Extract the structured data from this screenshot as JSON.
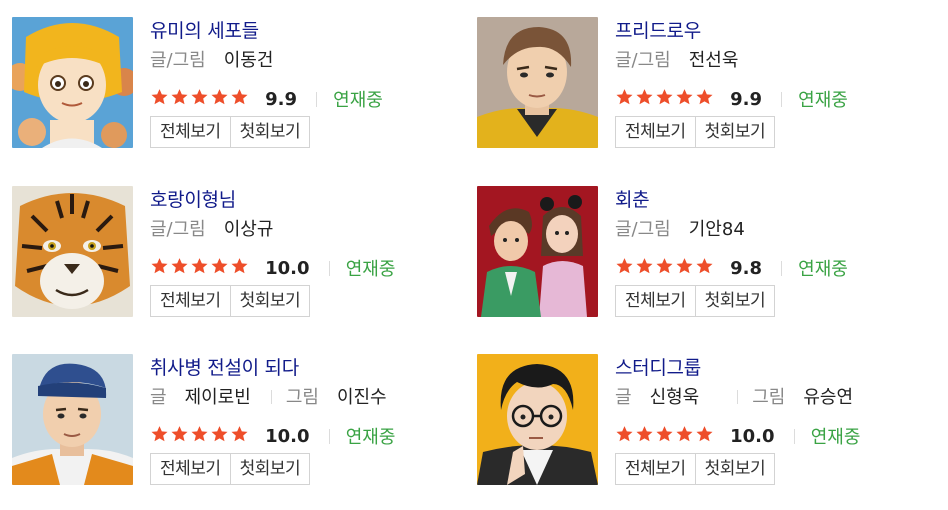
{
  "webtoons": [
    {
      "title": "유미의 세포들",
      "credits": [
        {
          "label": "글/그림",
          "name": "이동건"
        }
      ],
      "rating": "9.9",
      "stars": 5,
      "status": "연재중",
      "buttons": {
        "all": "전체보기",
        "first": "첫회보기"
      }
    },
    {
      "title": "프리드로우",
      "credits": [
        {
          "label": "글/그림",
          "name": "전선욱"
        }
      ],
      "rating": "9.9",
      "stars": 5,
      "status": "연재중",
      "buttons": {
        "all": "전체보기",
        "first": "첫회보기"
      }
    },
    {
      "title": "호랑이형님",
      "credits": [
        {
          "label": "글/그림",
          "name": "이상규"
        }
      ],
      "rating": "10.0",
      "stars": 5,
      "status": "연재중",
      "buttons": {
        "all": "전체보기",
        "first": "첫회보기"
      }
    },
    {
      "title": "회춘",
      "credits": [
        {
          "label": "글/그림",
          "name": "기안84"
        }
      ],
      "rating": "9.8",
      "stars": 5,
      "status": "연재중",
      "buttons": {
        "all": "전체보기",
        "first": "첫회보기"
      }
    },
    {
      "title": "취사병 전설이 되다",
      "credits": [
        {
          "label": "글",
          "name": "제이로빈"
        },
        {
          "label": "그림",
          "name": "이진수"
        }
      ],
      "rating": "10.0",
      "stars": 5,
      "status": "연재중",
      "buttons": {
        "all": "전체보기",
        "first": "첫회보기"
      }
    },
    {
      "title": "스터디그룹",
      "credits": [
        {
          "label": "글",
          "name": "신형욱"
        },
        {
          "label": "그림",
          "name": "유승연"
        }
      ],
      "rating": "10.0",
      "stars": 5,
      "status": "연재중",
      "buttons": {
        "all": "전체보기",
        "first": "첫회보기"
      }
    }
  ],
  "colors": {
    "title": "#111b8a",
    "star": "#ee4e2a",
    "status": "#3aa344"
  },
  "icons": {
    "star": "star-icon"
  }
}
